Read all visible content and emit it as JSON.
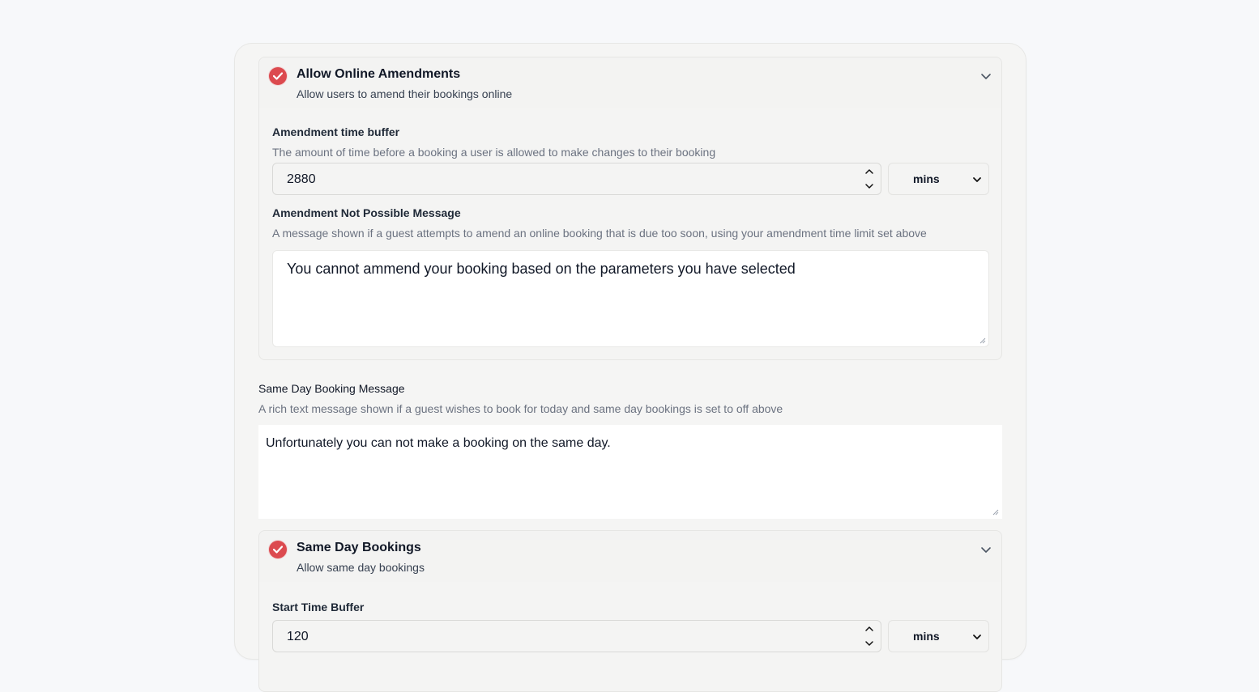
{
  "amendments": {
    "title": "Allow Online Amendments",
    "subtitle": "Allow users to amend their bookings online",
    "buffer_label": "Amendment time buffer",
    "buffer_help": "The amount of time before a booking a user is allowed to make changes to their booking",
    "buffer_value": "2880",
    "buffer_unit": "mins",
    "message_label": "Amendment Not Possible Message",
    "message_help": "A message shown if a guest attempts to amend an online booking that is due too soon, using your amendment time limit set above",
    "message_value": "You cannot ammend your booking based on the parameters you have selected"
  },
  "same_day_message": {
    "label": "Same Day Booking Message",
    "help": "A rich text message shown if a guest wishes to book for today and same day bookings is set to off above",
    "value": "Unfortunately you can not make a booking on the same day."
  },
  "same_day_bookings": {
    "title": "Same Day Bookings",
    "subtitle": "Allow same day bookings",
    "buffer_label": "Start Time Buffer",
    "buffer_value": "120",
    "buffer_unit": "mins"
  },
  "colors": {
    "accent": "#dc4a4f",
    "background": "#f7f8fa",
    "card": "#f5f5f4"
  },
  "icons": [
    "check-circle-icon",
    "chevron-down-icon",
    "spinner-arrows-icon",
    "resize-grip-icon"
  ]
}
